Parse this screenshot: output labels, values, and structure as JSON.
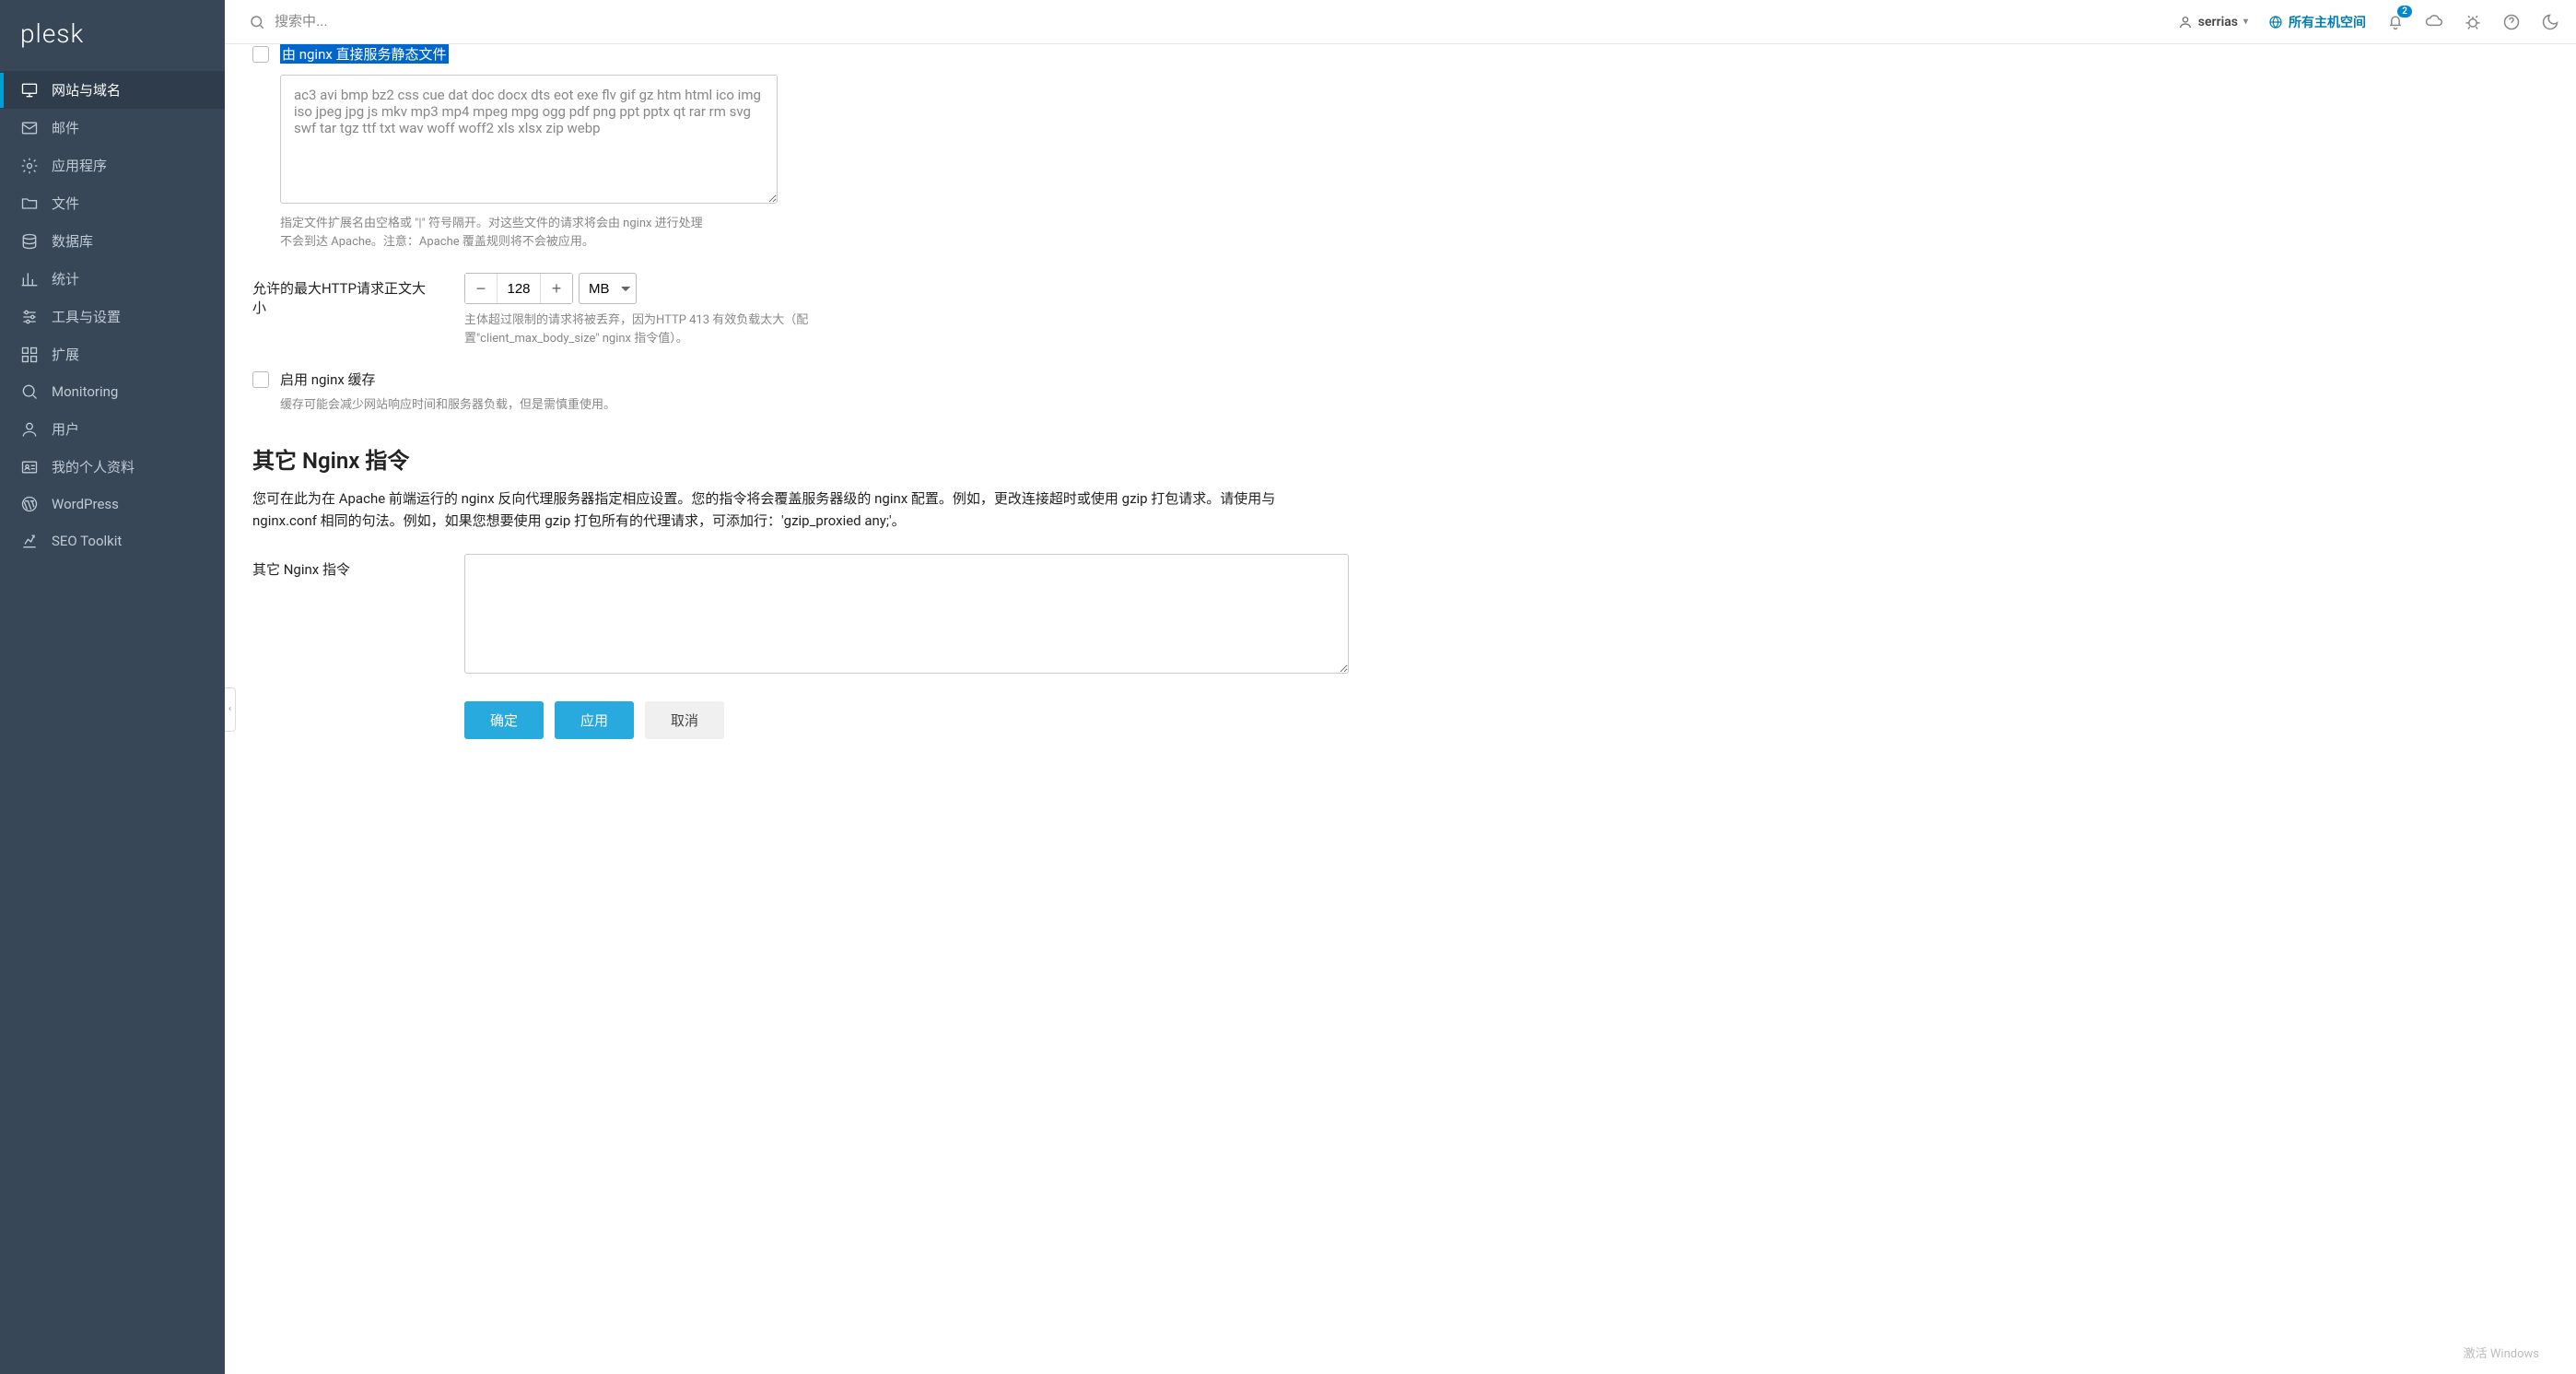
{
  "brand": "plesk",
  "topbar": {
    "search_placeholder": "搜索中...",
    "username": "serrias",
    "all_hosting": "所有主机空间",
    "notification_count": "2"
  },
  "sidebar": {
    "items": [
      {
        "label": "网站与域名"
      },
      {
        "label": "邮件"
      },
      {
        "label": "应用程序"
      },
      {
        "label": "文件"
      },
      {
        "label": "数据库"
      },
      {
        "label": "统计"
      },
      {
        "label": "工具与设置"
      },
      {
        "label": "扩展"
      },
      {
        "label": "Monitoring"
      },
      {
        "label": "用户"
      },
      {
        "label": "我的个人资料"
      },
      {
        "label": "WordPress"
      },
      {
        "label": "SEO Toolkit"
      }
    ]
  },
  "form": {
    "static_label": "由 nginx 直接服务静态文件",
    "ext_list": "ac3 avi bmp bz2 css cue dat doc docx dts eot exe flv gif gz htm html ico img iso jpeg jpg js mkv mp3 mp4 mpeg mpg ogg pdf png ppt pptx qt rar rm svg swf tar tgz ttf txt wav woff woff2 xls xlsx zip webp",
    "ext_hint": "指定文件扩展名由空格或 \"|\" 符号隔开。对这些文件的请求将会由 nginx 进行处理不会到达 Apache。注意：Apache 覆盖规则将不会被应用。",
    "max_body_label": "允许的最大HTTP请求正文大小",
    "max_body_value": "128",
    "max_body_unit": "MB",
    "max_body_hint": "主体超过限制的请求将被丢弃，因为HTTP 413 有效负载太大（配置\"client_max_body_size\" nginx 指令值）。",
    "cache_label": "启用 nginx 缓存",
    "cache_hint": "缓存可能会减少网站响应时间和服务器负载，但是需慎重使用。",
    "section_title": "其它 Nginx 指令",
    "section_desc": "您可在此为在 Apache 前端运行的 nginx 反向代理服务器指定相应设置。您的指令将会覆盖服务器级的 nginx 配置。例如，更改连接超时或使用 gzip 打包请求。请使用与 nginx.conf 相同的句法。例如，如果您想要使用 gzip 打包所有的代理请求，可添加行：'gzip_proxied any;'。",
    "directives_label": "其它 Nginx 指令",
    "btn_ok": "确定",
    "btn_apply": "应用",
    "btn_cancel": "取消"
  },
  "watermark": "激活 Windows"
}
